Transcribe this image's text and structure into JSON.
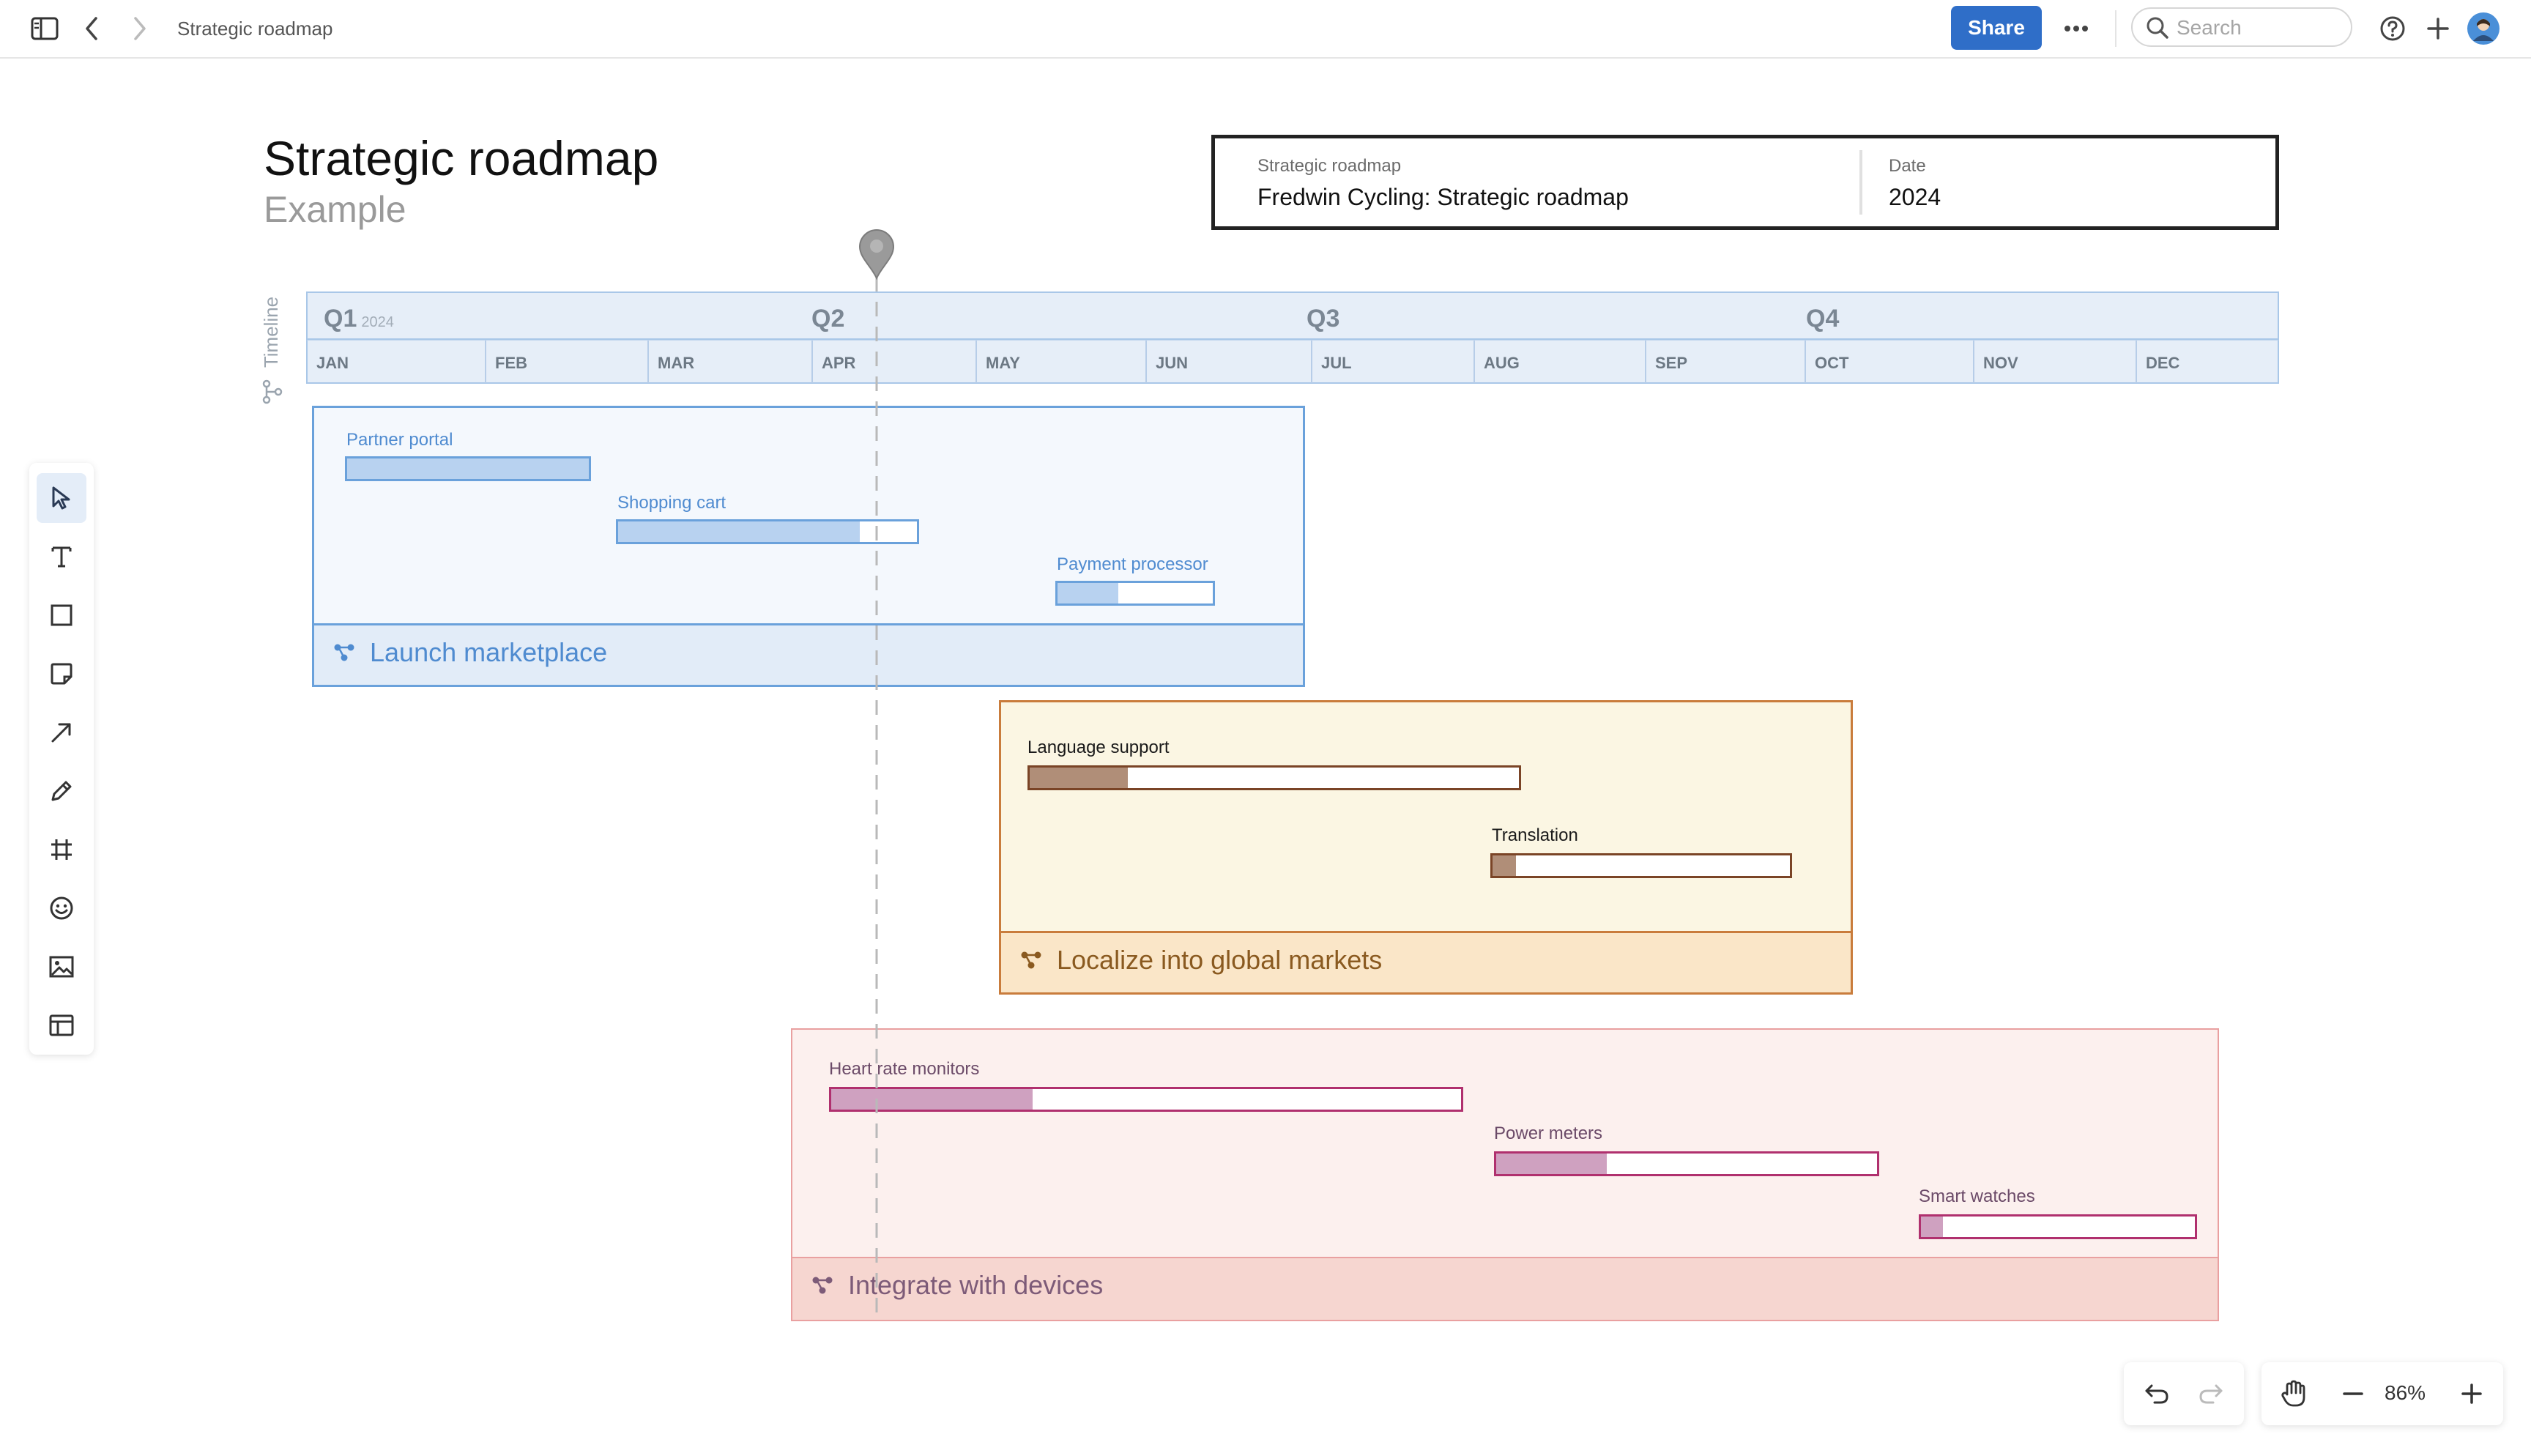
{
  "topbar": {
    "breadcrumb": "Strategic roadmap",
    "share_label": "Share",
    "search_placeholder": "Search",
    "icons": [
      "sidebar-toggle-icon",
      "back-arrow-icon",
      "forward-arrow-icon",
      "more-icon",
      "search-icon",
      "help-icon",
      "plus-icon",
      "avatar"
    ]
  },
  "page": {
    "title": "Strategic roadmap",
    "subtitle": "Example"
  },
  "info": {
    "label_left": "Strategic roadmap",
    "value_left": "Fredwin Cycling: Strategic roadmap",
    "label_right": "Date",
    "value_right": "2024"
  },
  "timeline": {
    "label": "Timeline",
    "quarters": [
      {
        "label": "Q1",
        "year": "2024"
      },
      {
        "label": "Q2"
      },
      {
        "label": "Q3"
      },
      {
        "label": "Q4"
      }
    ],
    "months": [
      "JAN",
      "FEB",
      "MAR",
      "APR",
      "MAY",
      "JUN",
      "JUL",
      "AUG",
      "SEP",
      "OCT",
      "NOV",
      "DEC"
    ]
  },
  "groups": [
    {
      "title": "Launch marketplace",
      "items": [
        {
          "label": "Partner portal",
          "progress": 1.0
        },
        {
          "label": "Shopping cart",
          "progress": 0.81
        },
        {
          "label": "Payment processor",
          "progress": 0.39
        }
      ]
    },
    {
      "title": "Localize into global markets",
      "items": [
        {
          "label": "Language support",
          "progress": 0.2
        },
        {
          "label": "Translation",
          "progress": 0.08
        }
      ]
    },
    {
      "title": "Integrate with devices",
      "items": [
        {
          "label": "Heart rate monitors",
          "progress": 0.32
        },
        {
          "label": "Power meters",
          "progress": 0.29
        },
        {
          "label": "Smart watches",
          "progress": 0.08
        }
      ]
    }
  ],
  "toolbar": {
    "tools": [
      "select-icon",
      "text-icon",
      "rectangle-icon",
      "sticky-note-icon",
      "arrow-icon",
      "pen-icon",
      "frame-icon",
      "emoji-icon",
      "image-icon",
      "template-icon"
    ]
  },
  "zoom": {
    "level": "86%"
  },
  "colors": {
    "accent": "#2f6ec8",
    "group1": "#6aa1db",
    "group2": "#c97c3c",
    "group3": "#e9a0a0"
  }
}
